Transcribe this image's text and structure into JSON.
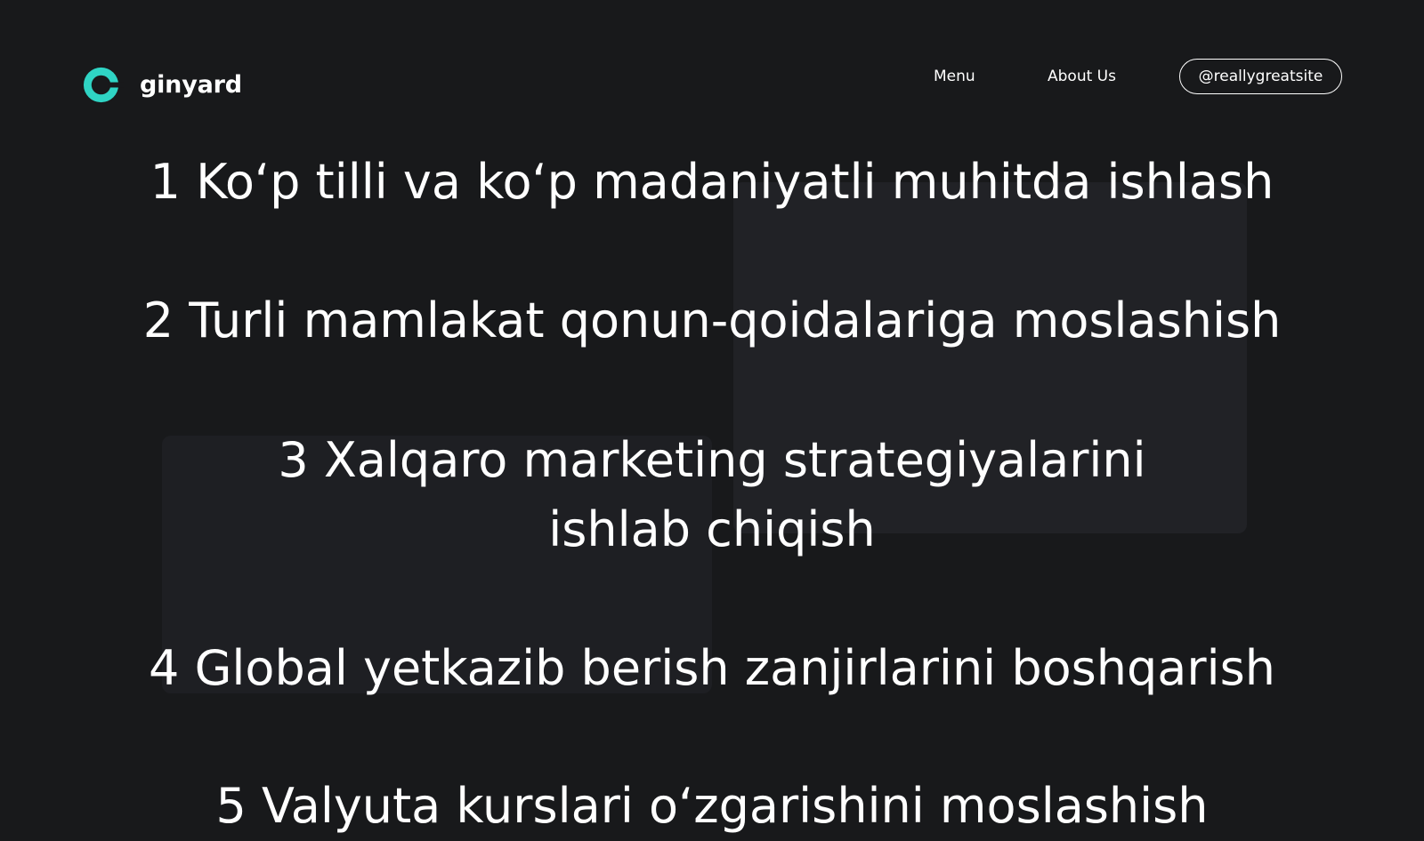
{
  "brand": {
    "name": "ginyard",
    "logo_icon": "ring-logo-icon",
    "accent_color": "#2fd4c4"
  },
  "nav": {
    "menu_label": "Menu",
    "about_label": "About Us",
    "handle_label": "@reallygreatsite"
  },
  "content": {
    "items": [
      "1 Ko‘p tilli va ko‘p madaniyatli muhitda ishlash",
      "2 Turli mamlakat qonun-qoidalariga moslashish",
      "3 Xalqaro marketing strategiyalarini ishlab chiqish",
      "4 Global yetkazib berish zanjirlarini boshqarish",
      "5 Valyuta kurslari o‘zgarishini moslashish"
    ]
  },
  "colors": {
    "background": "#18191b",
    "panel": "#212226",
    "text": "#ffffff"
  }
}
